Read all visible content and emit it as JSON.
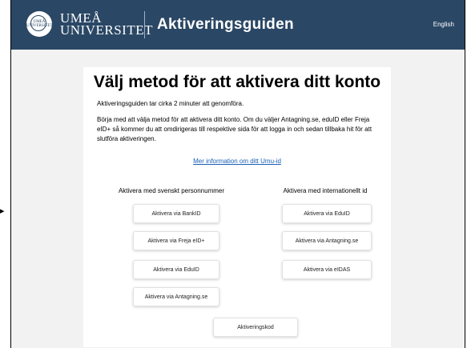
{
  "header": {
    "brand_line1": "UMEÅ",
    "brand_line2": "UNIVERSITET",
    "seal_text": "UMEÅ UNIVERSITET",
    "app_title": "Aktiveringsguiden",
    "language_link": "English"
  },
  "main": {
    "title": "Välj metod för att aktivera ditt konto",
    "intro": "Aktiveringsguiden tar cirka 2 minuter att genomföra.",
    "description": "Börja med att välja metod för att aktivera ditt konto. Om du väljer Antagning.se, eduID eller Freja eID+ så kommer du att omdirigeras till respektive sida för att logga in och sedan tillbaka hit för att slutföra aktiveringen.",
    "more_info_link": "Mer information om ditt Umu-id",
    "left_column": {
      "heading": "Aktivera med svenskt personnummer",
      "buttons": [
        "Aktivera via BankID",
        "Aktivera via Freja eID+",
        "Aktivera via EduID",
        "Aktivera via Antagning.se"
      ]
    },
    "right_column": {
      "heading": "Aktivera med internationellt id",
      "buttons": [
        "Aktivera via EduID",
        "Aktivera via Antagning.se",
        "Aktivera via eIDAS"
      ]
    },
    "activation_code_button": "Aktiveringskod"
  },
  "colors": {
    "header_bg": "#2a4765",
    "page_bg": "#f2f2f2",
    "link": "#1a5fb4"
  },
  "icons": {
    "seal": "university-seal-icon",
    "arrow": "arrow-right-icon"
  }
}
